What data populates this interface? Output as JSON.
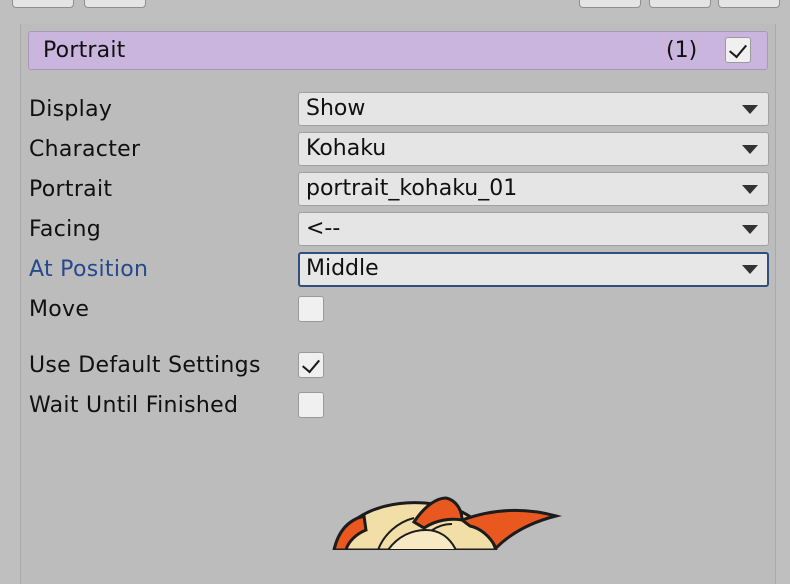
{
  "block": {
    "title": "Portrait",
    "count": "(1)",
    "enabled": true
  },
  "fields": {
    "display": {
      "label": "Display",
      "value": "Show"
    },
    "character": {
      "label": "Character",
      "value": "Kohaku"
    },
    "portrait": {
      "label": "Portrait",
      "value": "portrait_kohaku_01"
    },
    "facing": {
      "label": "Facing",
      "value": "<--"
    },
    "at_position": {
      "label": "At Position",
      "value": "Middle"
    },
    "move": {
      "label": "Move",
      "checked": false
    },
    "use_default_settings": {
      "label": "Use Default Settings",
      "checked": true
    },
    "wait_until_finished": {
      "label": "Wait Until Finished",
      "checked": false
    }
  },
  "colors": {
    "header": "#c9b5dd",
    "focused_label": "#244a8d",
    "panel": "#bcbcbc"
  },
  "icons": {
    "dropdown_arrow": "chevron-down-icon",
    "checkbox_mark": "check-icon",
    "preview": "portrait-preview-image"
  }
}
